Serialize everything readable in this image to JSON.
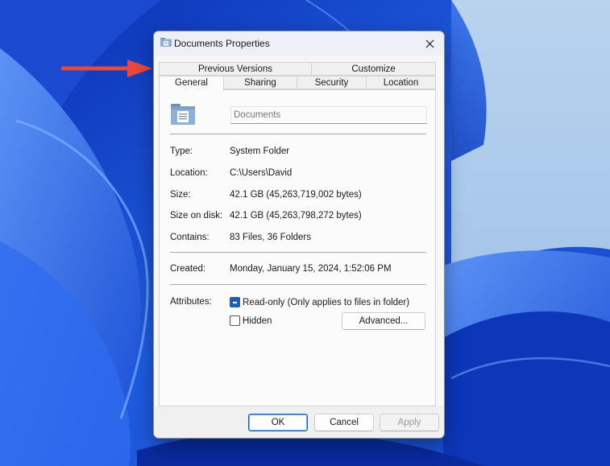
{
  "window": {
    "title": "Documents Properties"
  },
  "tabs_top": [
    {
      "label": "Previous Versions"
    },
    {
      "label": "Customize"
    }
  ],
  "tabs_bottom": [
    {
      "label": "General"
    },
    {
      "label": "Sharing"
    },
    {
      "label": "Security"
    },
    {
      "label": "Location"
    }
  ],
  "active_tab": "General",
  "general": {
    "name_value": "Documents",
    "type": {
      "label": "Type:",
      "value": "System Folder"
    },
    "location": {
      "label": "Location:",
      "value": "C:\\Users\\David"
    },
    "size": {
      "label": "Size:",
      "value": "42.1 GB (45,263,719,002 bytes)"
    },
    "size_on_disk": {
      "label": "Size on disk:",
      "value": "42.1 GB (45,263,798,272 bytes)"
    },
    "contains": {
      "label": "Contains:",
      "value": "83 Files, 36 Folders"
    },
    "created": {
      "label": "Created:",
      "value": "Monday, January 15, 2024, 1:52:06 PM"
    },
    "attributes": {
      "label": "Attributes:",
      "readonly_label": "Read-only (Only applies to files in folder)",
      "readonly_state": "indeterminate",
      "hidden_label": "Hidden",
      "hidden_state": "unchecked",
      "advanced_label": "Advanced..."
    }
  },
  "footer": {
    "ok_label": "OK",
    "cancel_label": "Cancel",
    "apply_label": "Apply"
  },
  "icons": {
    "close": "close-icon",
    "folder": "documents-folder-icon",
    "arrow": "red-arrow-annotation"
  },
  "colors": {
    "accent": "#1d5fb0",
    "arrow": "#e8493a",
    "wallpaper": "#1d54d6"
  }
}
